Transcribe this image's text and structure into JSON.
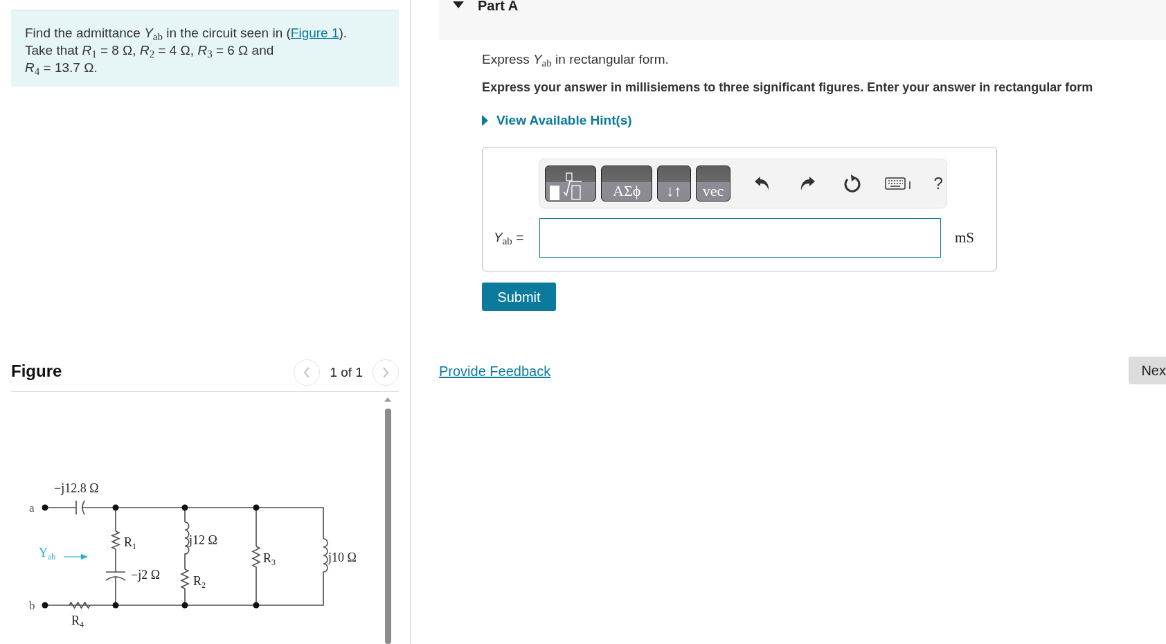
{
  "problem": {
    "text_before": "Find the admittance *Y*$_{ab}$ in the circuit seen in (",
    "link": "Figure 1",
    "text_after": ").\nTake that *R*$_{1}$ = 8 Ω, *R*$_{2}$ = 4 Ω, *R*$_{3}$ = 6 Ω and\n*R*$_{4}$ = 13.7 Ω."
  },
  "figure": {
    "title": "Figure",
    "pager": "1 of 1",
    "circuit": {
      "terminals": [
        "a",
        "b"
      ],
      "admittance_label": {
        "text": "Y",
        "sub": "ab"
      },
      "labels": [
        {
          "text": "−j12.8 Ω"
        },
        {
          "text": "R",
          "sub": "1"
        },
        {
          "text": "j12 Ω"
        },
        {
          "text": "R",
          "sub": "3"
        },
        {
          "text": "j10 Ω"
        },
        {
          "text": "−j2 Ω"
        },
        {
          "text": "R",
          "sub": "2"
        },
        {
          "text": "R",
          "sub": "4"
        }
      ]
    }
  },
  "part": {
    "title": "Part A",
    "expanded": true,
    "prompt": "Express *Y*$_{ab}$ in rectangular form.",
    "instruction": "Express your answer in millisiemens to three significant figures. Enter your answer in rectangular form",
    "hints": "View Available Hint(s)",
    "toolbar": [
      {
        "kind": "template"
      },
      {
        "kind": "text",
        "label": "ΑΣϕ"
      },
      {
        "kind": "text",
        "label": "↓↑"
      },
      {
        "kind": "text",
        "label": "vec"
      },
      {
        "kind": "undo"
      },
      {
        "kind": "redo"
      },
      {
        "kind": "reset"
      },
      {
        "kind": "keyboard"
      },
      {
        "kind": "help",
        "label": "?"
      }
    ],
    "answer_label": "*Y*$_{ab}$ =",
    "unit": "mS",
    "submit": "Submit"
  },
  "feedback": "Provide Feedback",
  "next": "Nex"
}
